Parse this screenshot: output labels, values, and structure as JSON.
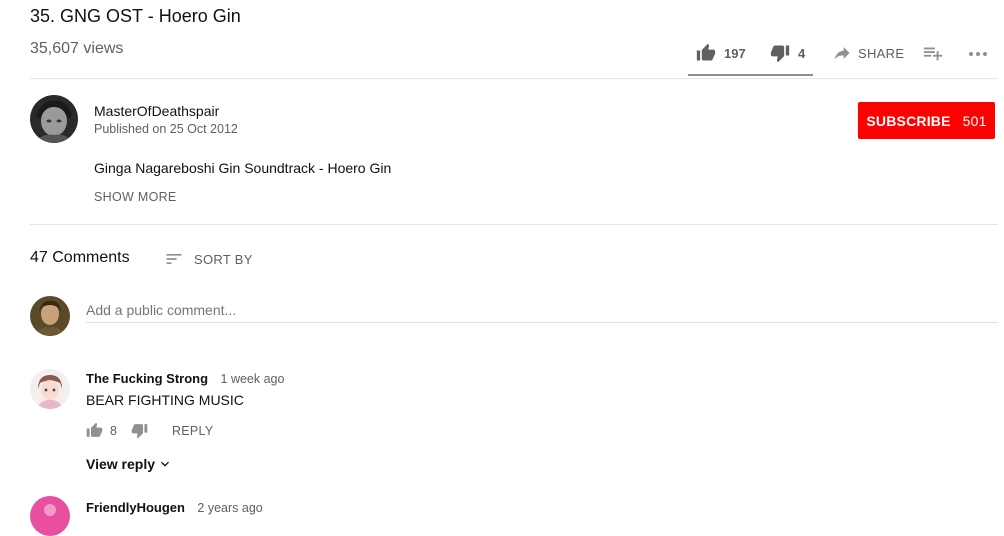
{
  "video": {
    "title": "35. GNG OST - Hoero Gin",
    "views": "35,607 views",
    "likes": "197",
    "dislikes": "4",
    "share_label": "SHARE"
  },
  "channel": {
    "name": "MasterOfDeathspair",
    "published": "Published on 25 Oct 2012",
    "subscribe_label": "SUBSCRIBE",
    "subscriber_count": "501",
    "description": "Ginga Nagareboshi Gin Soundtrack - Hoero Gin",
    "show_more": "SHOW MORE"
  },
  "comments_section": {
    "count_label": "47 Comments",
    "sort_label": "SORT BY",
    "add_placeholder": "Add a public comment...",
    "comments": [
      {
        "author": "The Fucking Strong",
        "time": "1 week ago",
        "text": "BEAR FIGHTING MUSIC",
        "likes": "8",
        "reply_label": "REPLY",
        "view_reply": "View reply"
      },
      {
        "author": "FriendlyHougen",
        "time": "2 years ago"
      }
    ]
  },
  "colors": {
    "subscribe_bg": "#ff0000",
    "secondary_text": "#606060"
  }
}
